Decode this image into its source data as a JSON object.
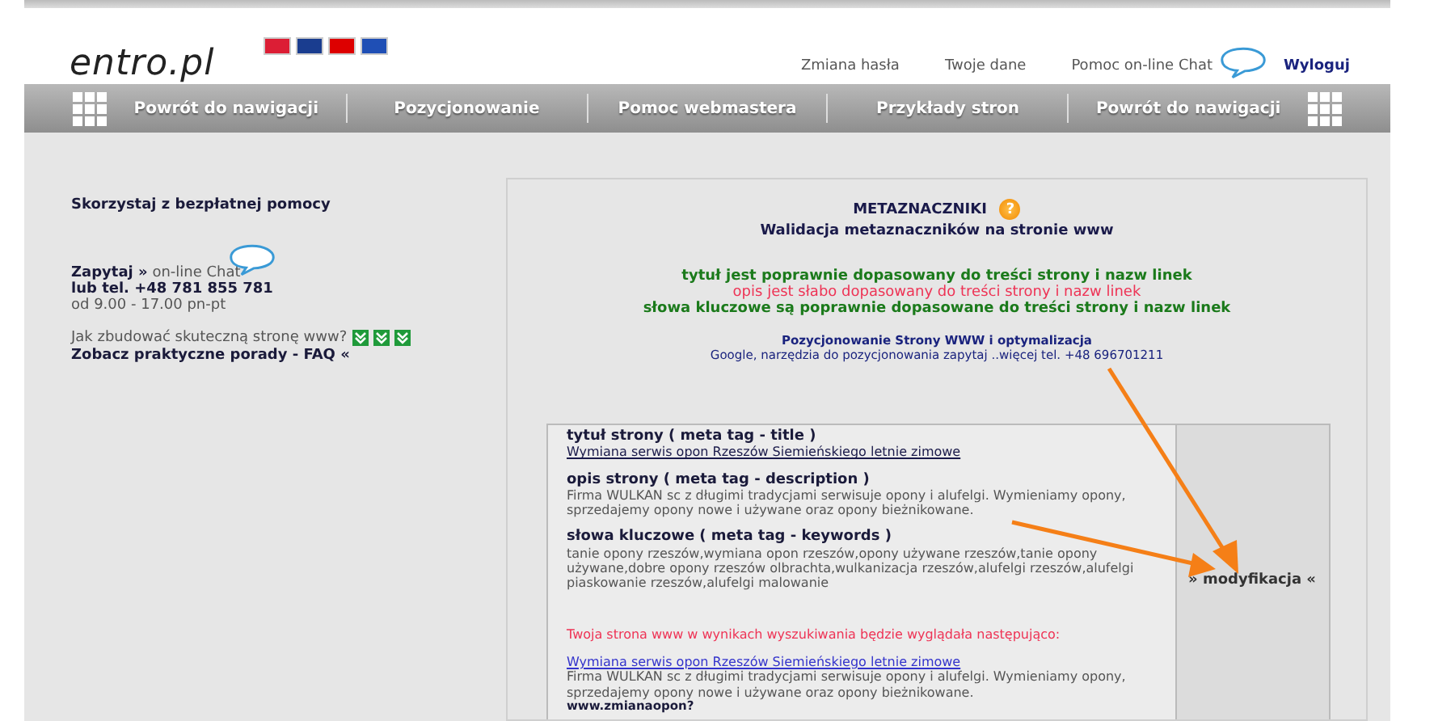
{
  "header": {
    "logo": "entro.pl",
    "flags": [
      {
        "color": "#dc1e35"
      },
      {
        "color": "#1a3d8f"
      },
      {
        "color": "#dd0000"
      },
      {
        "color": "#1f4fb5"
      }
    ],
    "links": [
      "Zmiana hasła",
      "Twoje dane",
      "Pomoc on-line Chat"
    ],
    "logout": "Wyloguj"
  },
  "nav": [
    "Powrót do nawigacji",
    "Pozycjonowanie",
    "Pomoc webmastera",
    "Przykłady stron",
    "Powrót do nawigacji"
  ],
  "sidebar": {
    "heading": "Skorzystaj z bezpłatnej pomocy",
    "ask": "Zapytaj »",
    "chat": "on-line Chat",
    "phone": "lub tel. +48 781 855 781",
    "hours": "od 9.00 - 17.00 pn-pt",
    "question": "Jak zbudować skuteczną stronę www?",
    "faq": "Zobacz praktyczne porady - FAQ «"
  },
  "main": {
    "title": "METAZNACZNIKI",
    "help": "?",
    "subtitle": "Walidacja metaznaczników na stronie www",
    "results": [
      {
        "text": "tytuł jest poprawnie dopasowany do treści strony i nazw linek",
        "kind": "ok"
      },
      {
        "text": "opis jest słabo dopasowany do treści strony i nazw linek",
        "kind": "weak"
      },
      {
        "text": "słowa kluczowe są poprawnie dopasowane do treści strony i nazw linek",
        "kind": "ok"
      }
    ],
    "promo_title": "Pozycjonowanie Strony WWW i optymalizacja",
    "promo_text": "Google, narzędzia do pozycjonowania zapytaj ..więcej tel. +48 696701211",
    "meta": [
      {
        "label": "tytuł strony ( meta tag - title )",
        "value": "Wymiana serwis opon Rzeszów Siemieńskiego letnie zimowe",
        "kind": "link"
      },
      {
        "label": "opis strony ( meta tag - description )",
        "value": "Firma WULKAN sc z długimi tradycjami serwisuje opony i alufelgi. Wymieniamy opony, sprzedajemy opony nowe i używane oraz opony bieżnikowane.",
        "kind": "text"
      },
      {
        "label": "słowa kluczowe ( meta tag - keywords )",
        "value": "tanie opony rzeszów,wymiana opon rzeszów,opony używane rzeszów,tanie opony używane,dobre opony rzeszów olbrachta,wulkanizacja rzeszów,alufelgi rzeszów,alufelgi piaskowanie rzeszów,alufelgi malowanie",
        "kind": "text"
      }
    ],
    "preview_intro": "Twoja strona www w wynikach wyszukiwania będzie wyglądała następująco:",
    "preview_title": "Wymiana serwis opon Rzeszów Siemieńskiego letnie zimowe",
    "preview_text": "Firma WULKAN sc z długimi tradycjami serwisuje opony i alufelgi. Wymieniamy opony, sprzedajemy opony nowe i używane oraz opony bieżnikowane.",
    "preview_url": "www.zmianaopon?",
    "modify": "» modyfikacja «"
  }
}
